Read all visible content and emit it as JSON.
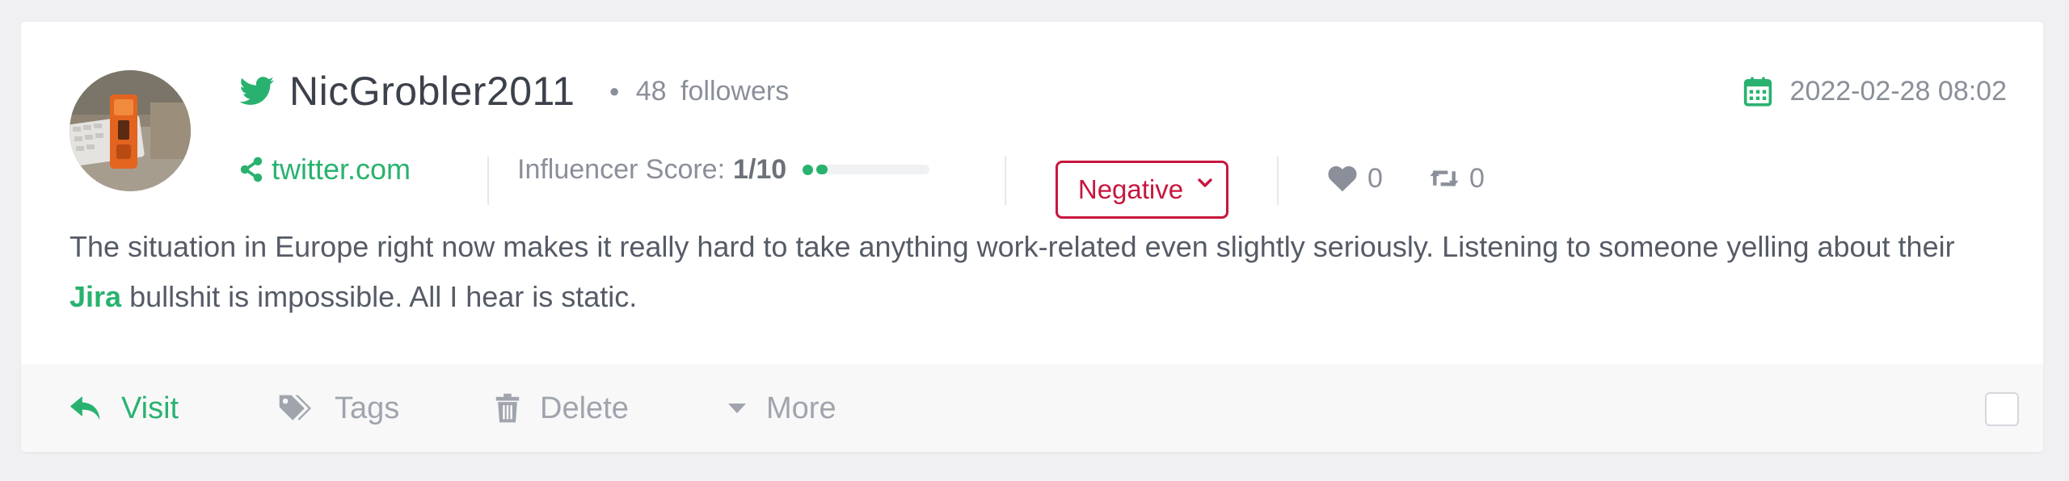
{
  "mention": {
    "author": {
      "name": "NicGrobler2011",
      "followers_count": "48",
      "followers_label": "followers",
      "network_icon": "twitter-bird-icon"
    },
    "date": "2022-02-28 08:02",
    "source": "twitter.com",
    "influencer": {
      "label": "Influencer Score:",
      "value": "1/10",
      "level": 0.1
    },
    "sentiment": "Negative",
    "likes": "0",
    "retweets": "0",
    "text_before": "The situation in Europe right now makes it really hard to take anything work-related even slightly seriously. Listening to someone yelling about their ",
    "keyword": "Jira",
    "text_after": " bullshit is impossible. All I hear is static."
  },
  "actions": {
    "visit": "Visit",
    "tags": "Tags",
    "delete": "Delete",
    "more": "More"
  },
  "colors": {
    "accent": "#29b26f",
    "negative": "#c8163e",
    "muted": "#8a8f99",
    "background": "#f0f0f3"
  }
}
